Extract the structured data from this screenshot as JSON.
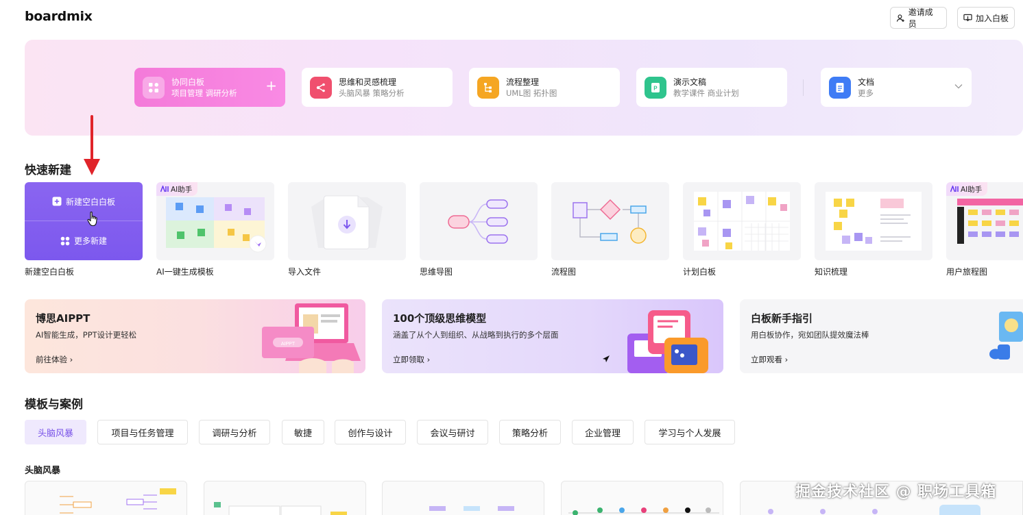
{
  "header": {
    "logo": "boardmix",
    "invite_label": "邀请成员",
    "join_label": "加入白板"
  },
  "hero": {
    "cards": [
      {
        "title": "协同白板",
        "subtitle": "项目管理 调研分析",
        "icon": "whiteboard-icon",
        "color": "#ffffff"
      },
      {
        "title": "思维和灵感梳理",
        "subtitle": "头脑风暴 策略分析",
        "icon": "mindmap-icon",
        "color": "#f0506e"
      },
      {
        "title": "流程整理",
        "subtitle": "UML图 拓扑图",
        "icon": "flow-icon",
        "color": "#f5a623"
      },
      {
        "title": "演示文稿",
        "subtitle": "教学课件 商业计划",
        "icon": "presentation-icon",
        "color": "#2fc48d"
      },
      {
        "title": "文档",
        "subtitle": "更多",
        "icon": "document-icon",
        "color": "#3f7cf5"
      }
    ]
  },
  "quick_create": {
    "title": "快速新建",
    "new_blank": "新建空白白板",
    "more_new": "更多新建",
    "ai_badge": "AI助手",
    "items": [
      {
        "label": "新建空白白板"
      },
      {
        "label": "AI一键生成模板"
      },
      {
        "label": "导入文件"
      },
      {
        "label": "思维导图"
      },
      {
        "label": "流程图"
      },
      {
        "label": "计划白板"
      },
      {
        "label": "知识梳理"
      },
      {
        "label": "用户旅程图"
      }
    ]
  },
  "promos": [
    {
      "title": "博思AIPPT",
      "subtitle": "AI智能生成，PPT设计更轻松",
      "link": "前往体验",
      "mock_label": "AIPPT"
    },
    {
      "title": "100个顶级思维模型",
      "subtitle": "涵盖了从个人到组织、从战略到执行的多个层面",
      "link": "立即领取"
    },
    {
      "title": "白板新手指引",
      "subtitle": "用白板协作，宛如团队提效魔法棒",
      "link": "立即观看"
    }
  ],
  "templates": {
    "title": "模板与案例",
    "tabs": [
      "头脑风暴",
      "项目与任务管理",
      "调研与分析",
      "敏捷",
      "创作与设计",
      "会议与研讨",
      "策略分析",
      "企业管理",
      "学习与个人发展"
    ],
    "active_tab": 0,
    "subsection": "头脑风暴"
  },
  "watermark": "掘金技术社区 @ 职场工具箱",
  "colors": {
    "accent": "#7c58ee",
    "pink": "#f47ad9",
    "arrow": "#e0242a"
  }
}
